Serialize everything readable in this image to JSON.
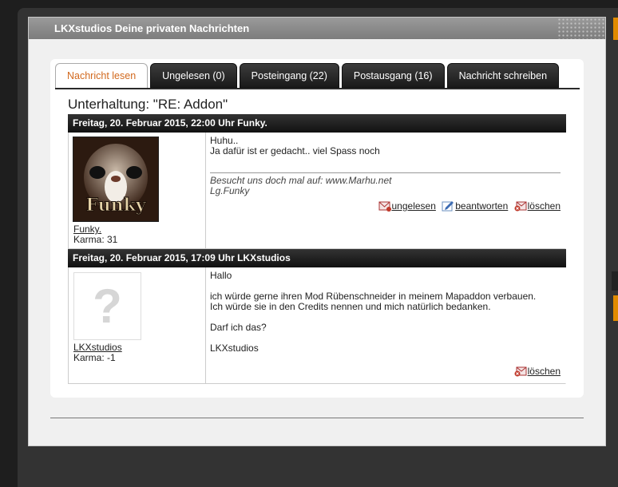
{
  "window": {
    "title": "LKXstudios Deine privaten Nachrichten"
  },
  "tabs": [
    {
      "label": "Nachricht lesen",
      "active": true
    },
    {
      "label": "Ungelesen (0)"
    },
    {
      "label": "Posteingang (22)"
    },
    {
      "label": "Postausgang (16)"
    },
    {
      "label": "Nachricht schreiben"
    }
  ],
  "conversation": {
    "title": "Unterhaltung: \"RE: Addon\""
  },
  "messages": [
    {
      "header": "Freitag, 20. Februar 2015, 22:00 Uhr Funky.",
      "author": "Funky.",
      "karma": "Karma: 31",
      "avatar_text": "Funky",
      "lines": [
        "Huhu..",
        "Ja dafür ist er gedacht.. viel Spass noch"
      ],
      "signature": [
        "Besucht uns doch mal auf: www.Marhu.net",
        "Lg.Funky"
      ],
      "actions": {
        "unread": "ungelesen",
        "reply": "beantworten",
        "delete": "löschen"
      }
    },
    {
      "header": "Freitag, 20. Februar 2015, 17:09 Uhr LKXstudios",
      "author": "LKXstudios",
      "karma": "Karma: -1",
      "avatar_placeholder": "?",
      "lines": [
        "Hallo",
        "ich würde gerne ihren Mod Rübenschneider in meinem Mapaddon verbauen.",
        "Ich würde sie in den Credits nennen und mich natürlich bedanken.",
        "Darf ich das?",
        "LKXstudios"
      ],
      "actions": {
        "delete": "löschen"
      }
    }
  ],
  "colors": {
    "accent": "#d2691e",
    "header_bg": "#1a1a1a",
    "side_accent": "#e08a00"
  }
}
